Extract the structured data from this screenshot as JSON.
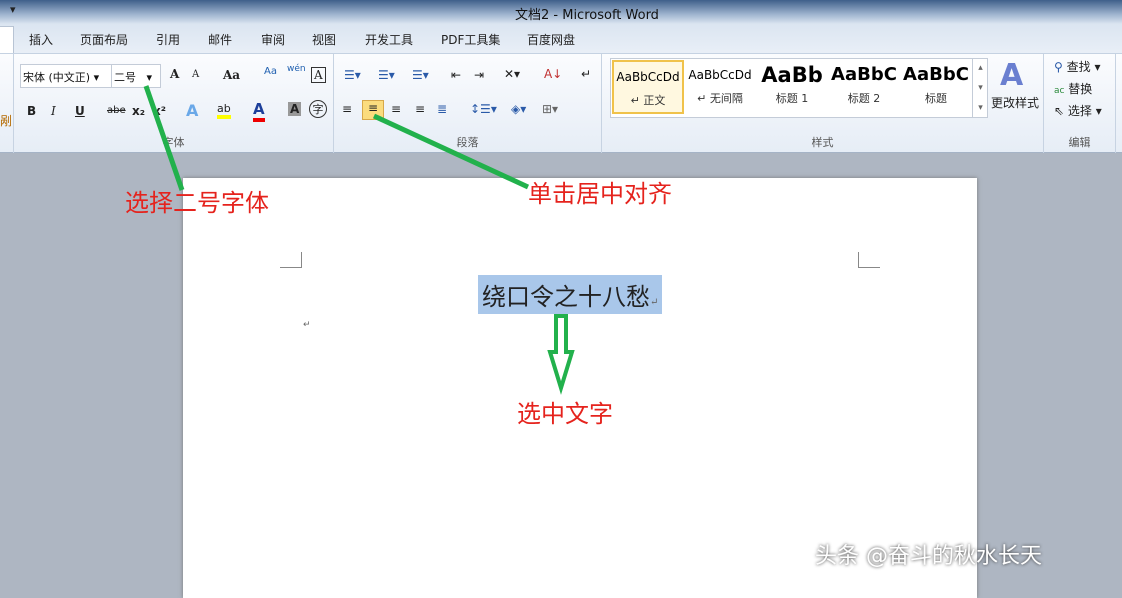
{
  "titlebar": {
    "title": "文档2 - Microsoft Word",
    "quick_access": "▾"
  },
  "tabs": [
    "插入",
    "页面布局",
    "引用",
    "邮件",
    "审阅",
    "视图",
    "开发工具",
    "PDF工具集",
    "百度网盘"
  ],
  "ribbon": {
    "clipboard_fragment": "剐",
    "font": {
      "label": "字体",
      "font_name": "宋体 (中文正)",
      "font_size": "二号",
      "grow": "A",
      "shrink": "A",
      "case": "Aa",
      "bold": "B",
      "italic": "I",
      "underline": "U",
      "strike": "abe",
      "sub": "x₂",
      "sup": "x²",
      "effects": "A",
      "highlight": "ab",
      "color": "A",
      "shade": "A",
      "enclose": "字",
      "phonetic": "wén",
      "border": "A"
    },
    "paragraph": {
      "label": "段落"
    },
    "styles": {
      "label": "样式",
      "items": [
        {
          "preview": "AaBbCcDd",
          "name": "↵ 正文"
        },
        {
          "preview": "AaBbCcDd",
          "name": "↵ 无间隔"
        },
        {
          "preview": "AaBb",
          "name": "标题 1"
        },
        {
          "preview": "AaBbC",
          "name": "标题 2"
        },
        {
          "preview": "AaBbC",
          "name": "标题"
        }
      ],
      "change": "更改样式"
    },
    "editing": {
      "label": "编辑",
      "find": "查找",
      "replace": "替换",
      "select": "选择"
    }
  },
  "document": {
    "text": "绕口令之十八愁",
    "para_mark": "↵"
  },
  "annotations": {
    "font_size": "选择二号字体",
    "center": "单击居中对齐",
    "select": "选中文字"
  },
  "watermark": "头条 @奋斗的秋水长天",
  "colors": {
    "annotation_line": "#22b14c",
    "annotation_text": "#e5231d",
    "selection": "#a9c7ea"
  }
}
